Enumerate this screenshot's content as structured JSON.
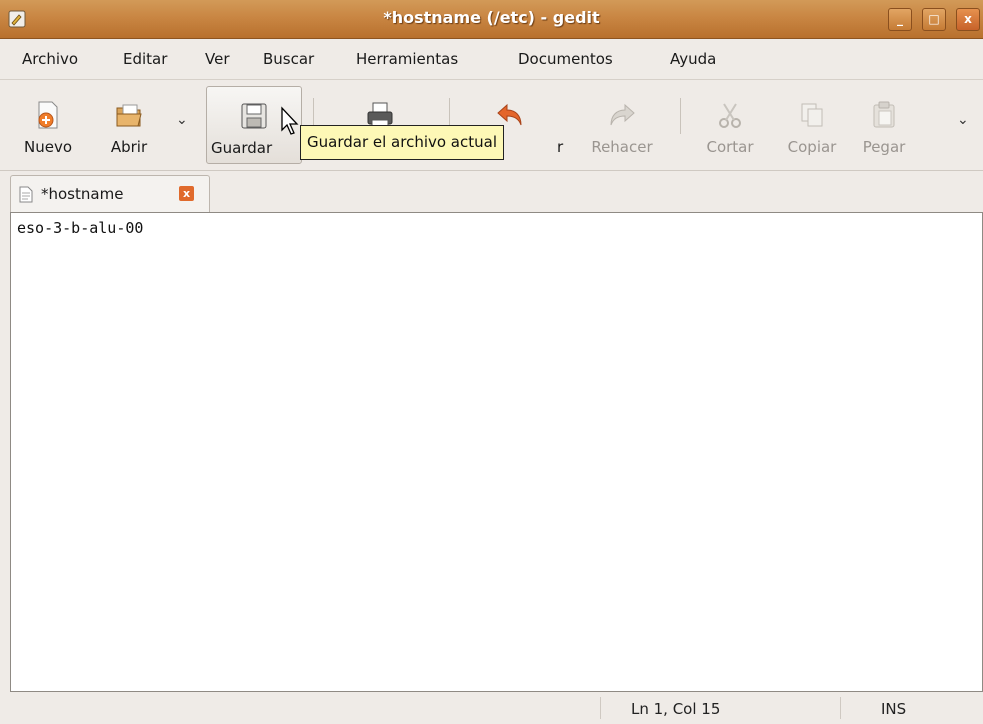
{
  "window": {
    "title": "*hostname (/etc) - gedit",
    "controls": {
      "minimize": "_",
      "maximize": "□",
      "close": "x"
    },
    "accent": "#c98643"
  },
  "menubar": [
    "Archivo",
    "Editar",
    "Ver",
    "Buscar",
    "Herramientas",
    "Documentos",
    "Ayuda"
  ],
  "toolbar": {
    "nuevo": "Nuevo",
    "abrir": "Abrir",
    "guardar": "Guardar",
    "imprimir_partial": "r",
    "rehacer": "Rehacer",
    "cortar": "Cortar",
    "copiar": "Copiar",
    "pegar": "Pegar",
    "icons": [
      "new-document-icon",
      "open-folder-icon",
      "floppy-save-icon",
      "printer-icon",
      "undo-arrow-icon",
      "redo-arrow-icon",
      "scissors-icon",
      "copy-icon",
      "paste-icon"
    ]
  },
  "tooltip": "Guardar el archivo actual",
  "tabs": [
    {
      "label": "*hostname",
      "close": "x"
    }
  ],
  "editor": {
    "content": "eso-3-b-alu-00"
  },
  "status": {
    "position": "Ln 1, Col 15",
    "mode": "INS"
  }
}
